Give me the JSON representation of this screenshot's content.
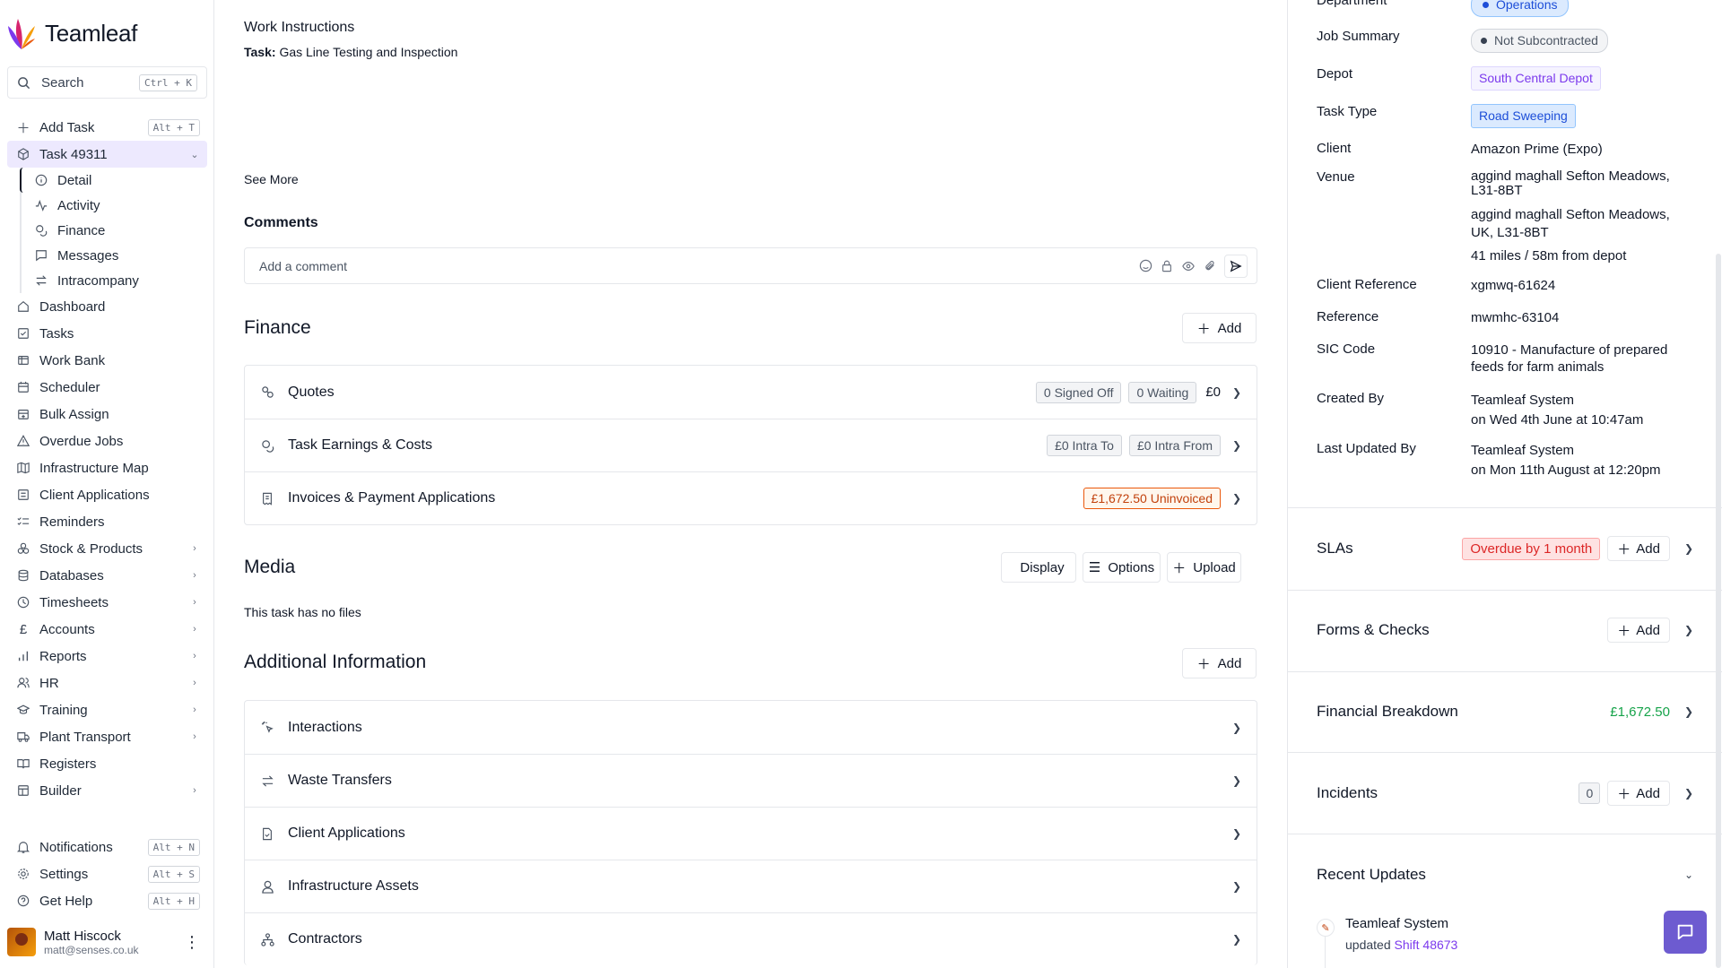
{
  "app": {
    "name": "Teamleaf"
  },
  "search": {
    "label": "Search",
    "shortcut": "Ctrl + K"
  },
  "nav": {
    "add_task": {
      "label": "Add Task",
      "shortcut": "Alt + T"
    },
    "task": {
      "label": "Task 49311"
    },
    "sub_items": [
      "Detail",
      "Activity",
      "Finance",
      "Messages",
      "Intracompany"
    ],
    "items": [
      "Dashboard",
      "Tasks",
      "Work Bank",
      "Scheduler",
      "Bulk Assign",
      "Overdue Jobs",
      "Infrastructure Map",
      "Client Applications",
      "Reminders",
      "Stock & Products",
      "Databases",
      "Timesheets",
      "Accounts",
      "Reports",
      "HR",
      "Training",
      "Plant Transport",
      "Registers",
      "Builder"
    ],
    "bottom": [
      {
        "label": "Notifications",
        "shortcut": "Alt + N"
      },
      {
        "label": "Settings",
        "shortcut": "Alt + S"
      },
      {
        "label": "Get Help",
        "shortcut": "Alt + H"
      }
    ]
  },
  "user": {
    "name": "Matt Hiscock",
    "email": "matt@senses.co.uk"
  },
  "main": {
    "work_instructions": {
      "title": "Work Instructions",
      "task_prefix": "Task:",
      "task_name": "Gas Line Testing and Inspection",
      "see_more": "See More"
    },
    "comments": {
      "title": "Comments",
      "placeholder": "Add a comment"
    },
    "finance": {
      "title": "Finance",
      "add_label": "Add",
      "rows": [
        {
          "label": "Quotes",
          "pills": [
            "0 Signed Off",
            "0 Waiting"
          ],
          "value": "£0"
        },
        {
          "label": "Task Earnings & Costs",
          "pills": [
            "£0 Intra To",
            "£0 Intra From"
          ]
        },
        {
          "label": "Invoices & Payment Applications",
          "warn": "£1,672.50 Uninvoiced"
        }
      ]
    },
    "media": {
      "title": "Media",
      "display_label": "Display",
      "options_label": "Options",
      "upload_label": "Upload",
      "empty": "This task has no files"
    },
    "additional": {
      "title": "Additional Information",
      "add_label": "Add",
      "rows": [
        "Interactions",
        "Waste Transfers",
        "Client Applications",
        "Infrastructure Assets",
        "Contractors"
      ]
    }
  },
  "details": {
    "department": {
      "label": "Department",
      "value": "Operations"
    },
    "job_summary": {
      "label": "Job Summary",
      "value": "Not Subcontracted"
    },
    "depot": {
      "label": "Depot",
      "value": "South Central Depot"
    },
    "task_type": {
      "label": "Task Type",
      "value": "Road Sweeping"
    },
    "client": {
      "label": "Client",
      "value": "Amazon Prime (Expo)"
    },
    "venue": {
      "label": "Venue",
      "line1": "aggind maghall Sefton Meadows,",
      "line2": "L31-8BT",
      "line3": "aggind maghall Sefton Meadows,",
      "line4": "UK, L31-8BT",
      "distance": "41 miles / 58m from depot"
    },
    "client_reference": {
      "label": "Client Reference",
      "value": "xgmwq-61624"
    },
    "reference": {
      "label": "Reference",
      "value": "mwmhc-63104"
    },
    "sic_code": {
      "label": "SIC Code",
      "line1": "10910 - Manufacture of prepared",
      "line2": "feeds for farm animals"
    },
    "created_by": {
      "label": "Created By",
      "name": "Teamleaf System",
      "date": "on Wed 4th June at 10:47am"
    },
    "last_updated_by": {
      "label": "Last Updated By",
      "name": "Teamleaf System",
      "date": "on Mon 11th August at 12:20pm"
    }
  },
  "panels": {
    "slas": {
      "title": "SLAs",
      "badge": "Overdue by 1 month",
      "add_label": "Add"
    },
    "forms": {
      "title": "Forms & Checks",
      "add_label": "Add"
    },
    "financial": {
      "title": "Financial Breakdown",
      "value": "£1,672.50"
    },
    "incidents": {
      "title": "Incidents",
      "count": "0",
      "add_label": "Add"
    },
    "recent": {
      "title": "Recent Updates",
      "actor": "Teamleaf System",
      "action": "updated",
      "link": "Shift 48673"
    }
  },
  "colors": {
    "accent": "#6d5bd0",
    "active_bg": "#ede9fe",
    "warn": "#ea580c",
    "danger": "#dc2626",
    "money": "#16a34a"
  }
}
